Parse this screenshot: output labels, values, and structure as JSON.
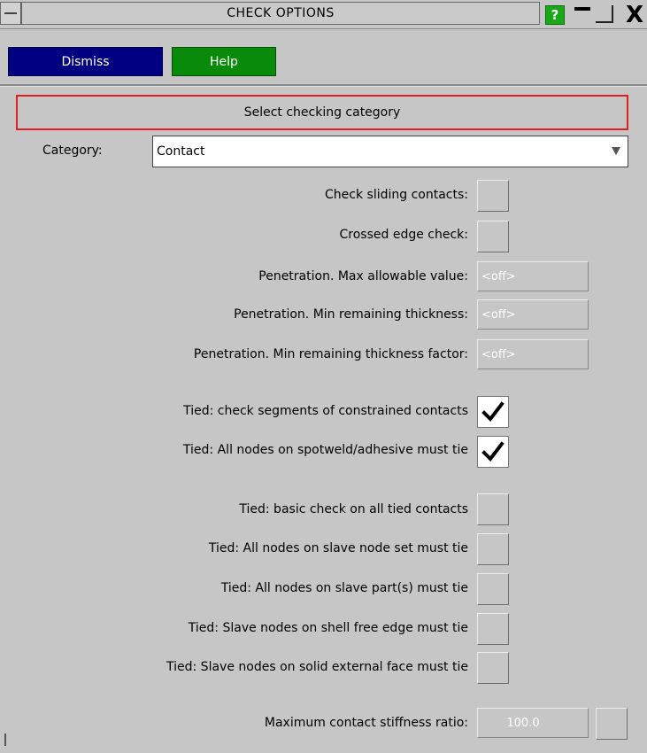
{
  "window": {
    "title": "CHECK OPTIONS",
    "help_glyph": "?",
    "close_glyph": "X"
  },
  "toolbar": {
    "dismiss_label": "Dismiss",
    "help_label": "Help"
  },
  "header": {
    "text": "Select checking category"
  },
  "category": {
    "label": "Category:",
    "value": "Contact"
  },
  "options": {
    "sliding": {
      "label": "Check sliding contacts:",
      "checked": false
    },
    "crossed": {
      "label": "Crossed edge check:",
      "checked": false
    },
    "pen_max": {
      "label": "Penetration. Max allowable value:",
      "value": "<off>"
    },
    "pen_min": {
      "label": "Penetration. Min remaining thickness:",
      "value": "<off>"
    },
    "pen_factor": {
      "label": "Penetration. Min remaining thickness factor:",
      "value": "<off>"
    },
    "tied_segments": {
      "label": "Tied: check segments of constrained contacts",
      "checked": true
    },
    "tied_spotweld": {
      "label": "Tied: All nodes on spotweld/adhesive must tie",
      "checked": true
    },
    "tied_basic": {
      "label": "Tied: basic check on all tied contacts",
      "checked": false
    },
    "tied_slave_set": {
      "label": "Tied: All nodes on slave node set must tie",
      "checked": false
    },
    "tied_slave_parts": {
      "label": "Tied: All nodes on slave part(s) must tie",
      "checked": false
    },
    "tied_shell_edge": {
      "label": "Tied: Slave nodes on shell free edge must tie",
      "checked": false
    },
    "tied_solid_face": {
      "label": "Tied: Slave nodes on solid external face must tie",
      "checked": false
    },
    "stiffness": {
      "label": "Maximum contact stiffness ratio:",
      "value": "100.0"
    }
  },
  "colors": {
    "panel_bg": "#c6c6c6",
    "dismiss_bg": "#000080",
    "help_bg": "#0a8a0a",
    "header_border": "#e02020",
    "title_help_bg": "#1aa81a"
  },
  "icons": {
    "window_menu": "window-menu-icon",
    "help": "help-icon",
    "minimize": "minimize-icon",
    "maximize": "maximize-icon",
    "close": "close-icon",
    "dropdown": "dropdown-arrow-icon",
    "check": "checkmark-icon"
  }
}
